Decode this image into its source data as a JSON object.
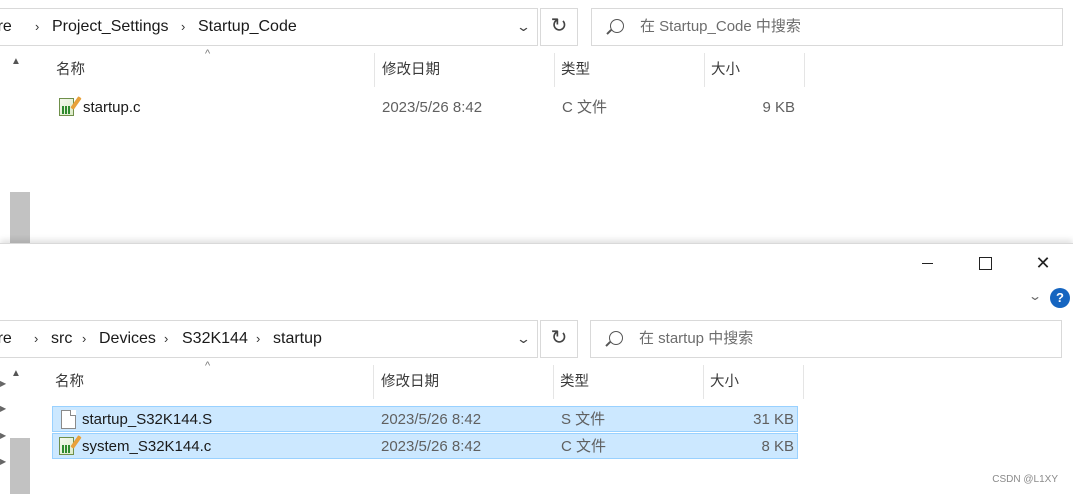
{
  "top_window": {
    "breadcrumb": [
      "Bare",
      "Project_Settings",
      "Startup_Code"
    ],
    "search_placeholder": "在 Startup_Code 中搜索",
    "columns": {
      "name": "名称",
      "date": "修改日期",
      "type": "类型",
      "size": "大小"
    },
    "files": [
      {
        "name": "startup.c",
        "date": "2023/5/26 8:42",
        "type": "C 文件",
        "size": "9 KB",
        "icon": "c-source-file-icon",
        "selected": false
      }
    ]
  },
  "bottom_window": {
    "caption": {
      "minimize_icon": "minimize-icon",
      "maximize_icon": "maximize-icon",
      "close_icon": "close-icon"
    },
    "help_label": "?",
    "breadcrumb": [
      "Bare",
      "src",
      "Devices",
      "S32K144",
      "startup"
    ],
    "search_placeholder": "在 startup 中搜索",
    "columns": {
      "name": "名称",
      "date": "修改日期",
      "type": "类型",
      "size": "大小"
    },
    "files": [
      {
        "name": "startup_S32K144.S",
        "date": "2023/5/26 8:42",
        "type": "S 文件",
        "size": "31 KB",
        "icon": "blank-file-icon",
        "selected": true
      },
      {
        "name": "system_S32K144.c",
        "date": "2023/5/26 8:42",
        "type": "C 文件",
        "size": "8 KB",
        "icon": "c-source-file-icon",
        "selected": true
      }
    ]
  },
  "watermark": "CSDN @L1XY"
}
